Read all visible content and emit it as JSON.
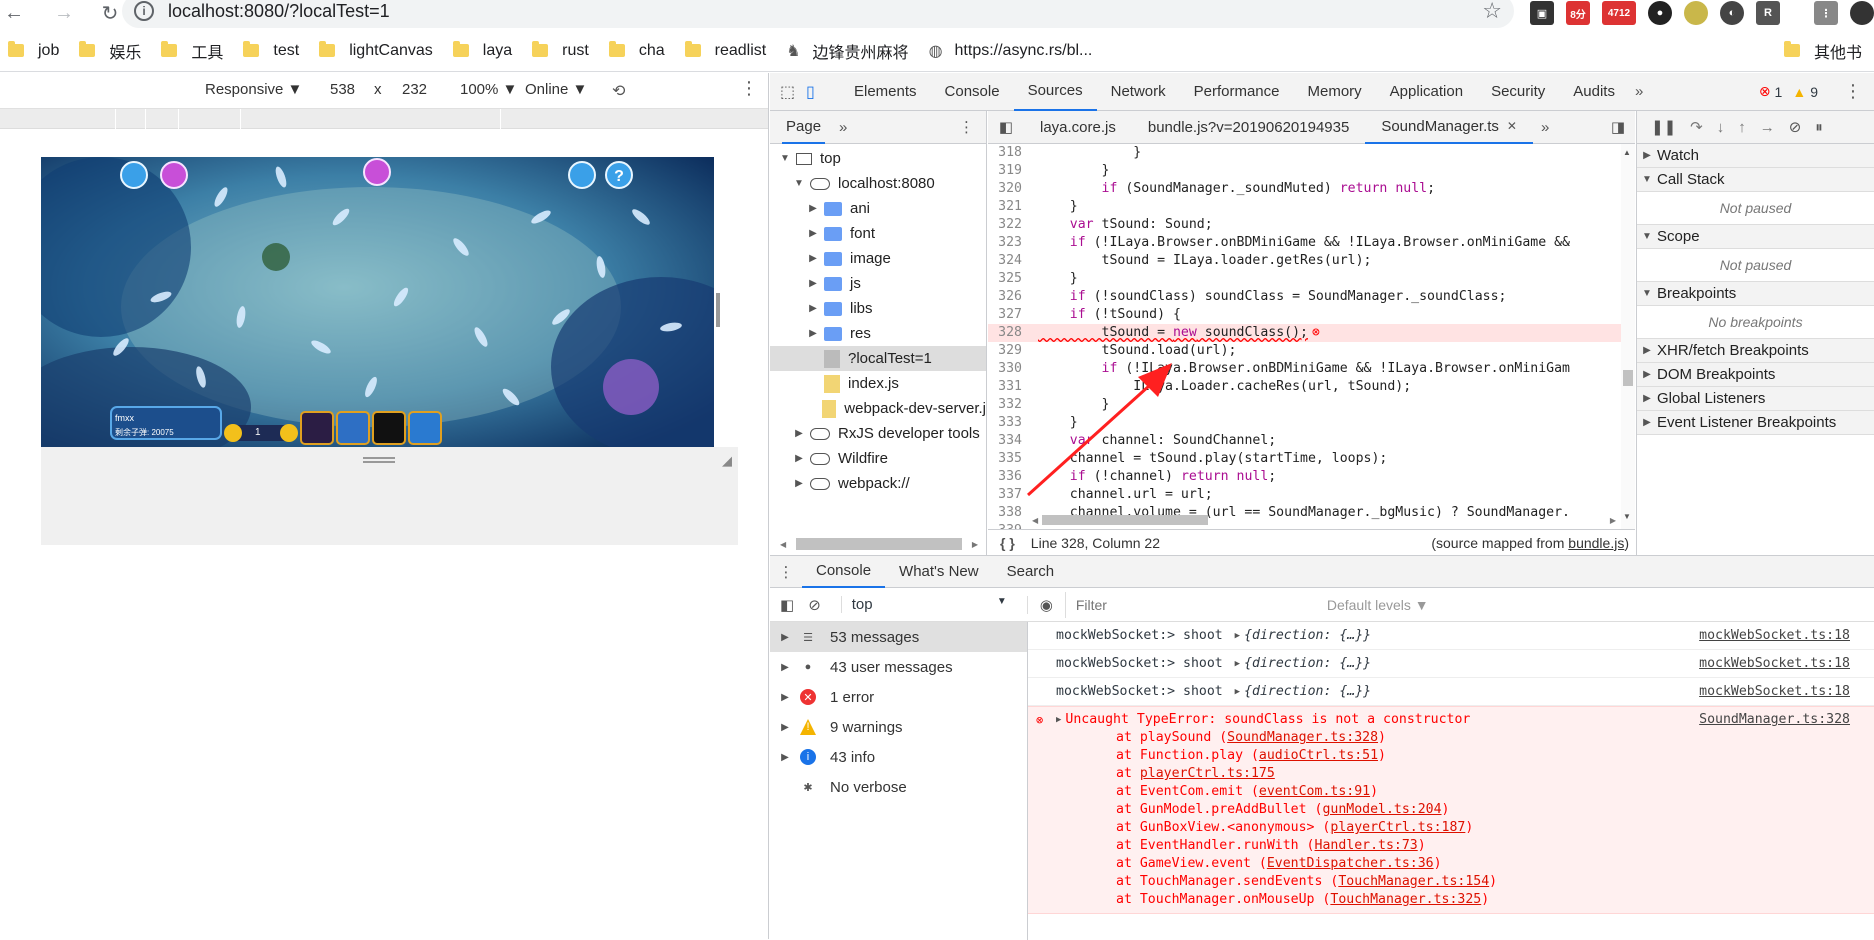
{
  "browser": {
    "url": "localhost:8080/?localTest=1",
    "bookmarks": [
      "job",
      "娱乐",
      "工具",
      "test",
      "lightCanvas",
      "laya",
      "rust",
      "cha",
      "readlist",
      "边锋贵州麻将",
      "https://async.rs/bl..."
    ],
    "other_bookmarks": "其他书",
    "ext_badges": [
      "8分",
      "4712",
      "R"
    ]
  },
  "device_toolbar": {
    "mode": "Responsive ▼",
    "width": "538",
    "times": "x",
    "height": "232",
    "zoom": "100% ▼",
    "network": "Online ▼"
  },
  "game": {
    "player_name": "fmxx",
    "ammo_label": "剩余子弹: 20075",
    "bet": "1"
  },
  "devtools": {
    "tabs": [
      "Elements",
      "Console",
      "Sources",
      "Network",
      "Performance",
      "Memory",
      "Application",
      "Security",
      "Audits"
    ],
    "active_tab": "Sources",
    "errors": "1",
    "warnings": "9",
    "nav_tab": "Page",
    "tree": [
      {
        "label": "top",
        "depth": 0,
        "type": "frame",
        "open": true
      },
      {
        "label": "localhost:8080",
        "depth": 1,
        "type": "cloud",
        "open": true
      },
      {
        "label": "ani",
        "depth": 2,
        "type": "folder"
      },
      {
        "label": "font",
        "depth": 2,
        "type": "folder"
      },
      {
        "label": "image",
        "depth": 2,
        "type": "folder"
      },
      {
        "label": "js",
        "depth": 2,
        "type": "folder"
      },
      {
        "label": "libs",
        "depth": 2,
        "type": "folder"
      },
      {
        "label": "res",
        "depth": 2,
        "type": "folder"
      },
      {
        "label": "?localTest=1",
        "depth": 2,
        "type": "file-grey",
        "selected": true
      },
      {
        "label": "index.js",
        "depth": 2,
        "type": "file"
      },
      {
        "label": "webpack-dev-server.j",
        "depth": 2,
        "type": "file"
      },
      {
        "label": "RxJS developer tools",
        "depth": 1,
        "type": "cloud"
      },
      {
        "label": "Wildfire",
        "depth": 1,
        "type": "cloud"
      },
      {
        "label": "webpack://",
        "depth": 1,
        "type": "cloud"
      }
    ],
    "editor_tabs": [
      "laya.core.js",
      "bundle.js?v=20190620194935",
      "SoundManager.ts"
    ],
    "active_editor_tab": "SoundManager.ts",
    "code": [
      {
        "n": "318",
        "t": "            }"
      },
      {
        "n": "319",
        "t": "        }"
      },
      {
        "n": "320",
        "t": "        if (SoundManager._soundMuted) return null;"
      },
      {
        "n": "321",
        "t": "    }"
      },
      {
        "n": "322",
        "t": "    var tSound: Sound;"
      },
      {
        "n": "323",
        "t": "    if (!ILaya.Browser.onBDMiniGame && !ILaya.Browser.onMiniGame &&"
      },
      {
        "n": "324",
        "t": "        tSound = ILaya.loader.getRes(url);"
      },
      {
        "n": "325",
        "t": "    }"
      },
      {
        "n": "326",
        "t": "    if (!soundClass) soundClass = SoundManager._soundClass;"
      },
      {
        "n": "327",
        "t": "    if (!tSound) {"
      },
      {
        "n": "328",
        "t": "        tSound = new soundClass();",
        "err": true
      },
      {
        "n": "329",
        "t": "        tSound.load(url);"
      },
      {
        "n": "330",
        "t": "        if (!ILaya.Browser.onBDMiniGame && !ILaya.Browser.onMiniGam"
      },
      {
        "n": "331",
        "t": "            ILaya.Loader.cacheRes(url, tSound);"
      },
      {
        "n": "332",
        "t": "        }"
      },
      {
        "n": "333",
        "t": "    }"
      },
      {
        "n": "334",
        "t": "    var channel: SoundChannel;"
      },
      {
        "n": "335",
        "t": "    channel = tSound.play(startTime, loops);"
      },
      {
        "n": "336",
        "t": "    if (!channel) return null;"
      },
      {
        "n": "337",
        "t": "    channel.url = url;"
      },
      {
        "n": "338",
        "t": "    channel.volume = (url == SoundManager._bgMusic) ? SoundManager."
      },
      {
        "n": "339",
        "t": ""
      }
    ],
    "status_position": "Line 328, Column 22",
    "status_mapped": "(source mapped from",
    "status_mapped_link": "bundle.js",
    "status_mapped_end": ")",
    "debugger_panes": [
      {
        "title": "Watch",
        "open": false
      },
      {
        "title": "Call Stack",
        "open": true,
        "body": "Not paused"
      },
      {
        "title": "Scope",
        "open": true,
        "body": "Not paused"
      },
      {
        "title": "Breakpoints",
        "open": true,
        "body": "No breakpoints"
      },
      {
        "title": "XHR/fetch Breakpoints",
        "open": false
      },
      {
        "title": "DOM Breakpoints",
        "open": false
      },
      {
        "title": "Global Listeners",
        "open": false
      },
      {
        "title": "Event Listener Breakpoints",
        "open": false
      }
    ]
  },
  "console": {
    "tabs": [
      "Console",
      "What's New",
      "Search"
    ],
    "context": "top",
    "filter_placeholder": "Filter",
    "levels": "Default levels ▼",
    "sidebar": [
      {
        "label": "53 messages",
        "icon": "list-icon",
        "selected": true
      },
      {
        "label": "43 user messages",
        "icon": "user-icon"
      },
      {
        "label": "1 error",
        "icon": "error-icon"
      },
      {
        "label": "9 warnings",
        "icon": "warning-icon"
      },
      {
        "label": "43 info",
        "icon": "info-icon"
      },
      {
        "label": "No verbose",
        "icon": "bug-icon"
      }
    ],
    "logs": [
      {
        "text": "mockWebSocket:> shoot ",
        "obj": "{direction: {…}}",
        "src": "mockWebSocket.ts:18"
      },
      {
        "text": "mockWebSocket:> shoot ",
        "obj": "{direction: {…}}",
        "src": "mockWebSocket.ts:18"
      },
      {
        "text": "mockWebSocket:> shoot ",
        "obj": "{direction: {…}}",
        "src": "mockWebSocket.ts:18"
      }
    ],
    "error": {
      "message": "Uncaught TypeError: soundClass is not a constructor",
      "src": "SoundManager.ts:328",
      "stack": [
        {
          "pre": "at playSound (",
          "link": "SoundManager.ts:328",
          "post": ")"
        },
        {
          "pre": "at Function.play (",
          "link": "audioCtrl.ts:51",
          "post": ")"
        },
        {
          "pre": "at ",
          "link": "playerCtrl.ts:175",
          "post": ""
        },
        {
          "pre": "at EventCom.emit (",
          "link": "eventCom.ts:91",
          "post": ")"
        },
        {
          "pre": "at GunModel.preAddBullet (",
          "link": "gunModel.ts:204",
          "post": ")"
        },
        {
          "pre": "at GunBoxView.<anonymous> (",
          "link": "playerCtrl.ts:187",
          "post": ")"
        },
        {
          "pre": "at EventHandler.runWith (",
          "link": "Handler.ts:73",
          "post": ")"
        },
        {
          "pre": "at GameView.event (",
          "link": "EventDispatcher.ts:36",
          "post": ")"
        },
        {
          "pre": "at TouchManager.sendEvents (",
          "link": "TouchManager.ts:154",
          "post": ")"
        },
        {
          "pre": "at TouchManager.onMouseUp (",
          "link": "TouchManager.ts:325",
          "post": ")"
        }
      ]
    }
  },
  "colors": {
    "accent": "#1a73e8",
    "error": "#ff0000",
    "error_bg": "#fff0f0",
    "folder": "#6a9ef5",
    "warning": "#f4b400"
  }
}
